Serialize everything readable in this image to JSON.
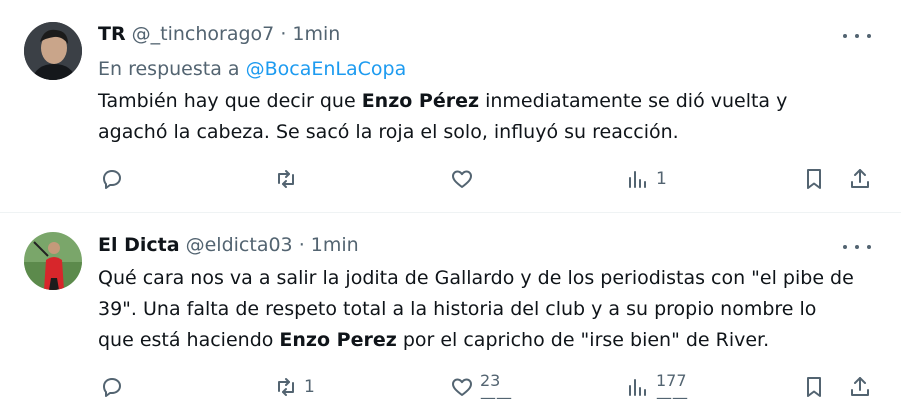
{
  "tweets": [
    {
      "name": "TR",
      "handle": "@_tinchorago7",
      "separator": "·",
      "time": "1min",
      "reply_prefix": "En respuesta a",
      "reply_handle": "@BocaEnLaCopa",
      "text_1": "También hay que decir que ",
      "bold_1": "Enzo Pérez",
      "text_2": " inmediatamente se dió vuelta y agachó la cabeza. Se sacó la roja el solo, influyó su reacción.",
      "replies": "",
      "retweets": "",
      "likes": "",
      "views": "1"
    },
    {
      "name": "El Dicta",
      "handle": "@eldicta03",
      "separator": "·",
      "time": "1min",
      "text_1": "Qué cara nos va a salir la jodita de Gallardo y de los periodistas con \"el pibe de 39\". Una falta de respeto total a la historia del club y a su propio nombre lo que está haciendo ",
      "bold_1": "Enzo Perez",
      "text_2": " por el capricho de \"irse bien\" de River.",
      "replies": "",
      "retweets": "1",
      "likes": "23",
      "views": "177"
    }
  ],
  "icons": [
    "more-icon",
    "reply-icon",
    "retweet-icon",
    "like-icon",
    "views-icon",
    "bookmark-icon",
    "share-icon"
  ],
  "colors": {
    "text": "#0f1419",
    "secondary": "#536471",
    "link": "#1d9bf0",
    "divider": "#eff3f4"
  }
}
